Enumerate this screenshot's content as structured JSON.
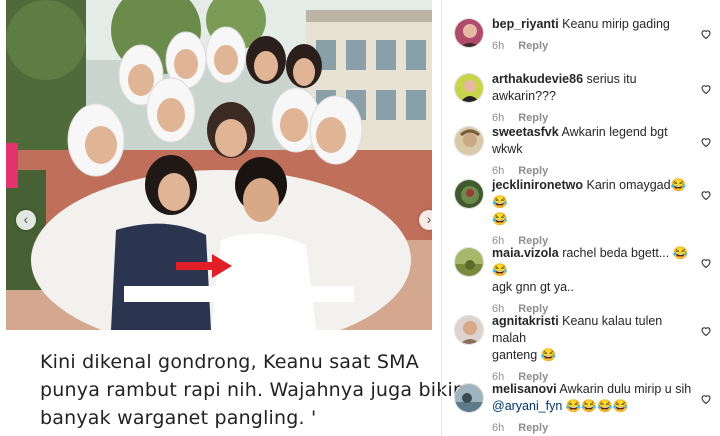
{
  "post": {
    "carousel": {
      "prev_icon": "‹",
      "next_icon": "›"
    },
    "caption_lines": [
      "Kini dikenal gondrong, Keanu saat SMA",
      "punya rambut rapi nih. Wajahnya juga bikin",
      "banyak warganet pangling. '"
    ]
  },
  "comments": [
    {
      "username": "bep_riyanti",
      "text": "Keanu mirip gading",
      "text2": "",
      "time": "6h",
      "reply": "Reply",
      "avatar_color": "#b04a6a"
    },
    {
      "username": "arthakudevie86",
      "text": "serius itu awkarin???",
      "text2": "",
      "time": "6h",
      "reply": "Reply",
      "avatar_color": "#c8d44a"
    },
    {
      "username": "sweetasfvk",
      "text": "Awkarin legend bgt wkwk",
      "text2": "",
      "time": "6h",
      "reply": "Reply",
      "avatar_color": "#d9c9a8"
    },
    {
      "username": "jecklinironetwo",
      "text": "Karin omaygad😂😂",
      "text2": "😂",
      "time": "6h",
      "reply": "Reply",
      "avatar_color": "#3f5a2e"
    },
    {
      "username": "maia.vizola",
      "text": "rachel beda bgett... 😂😂",
      "text2": "agk gnn gt ya..",
      "time": "6h",
      "reply": "Reply",
      "avatar_color": "#7b8a3a"
    },
    {
      "username": "agnitakristi",
      "text": "Keanu kalau tulen malah",
      "text2": "ganteng 😂",
      "time": "6h",
      "reply": "Reply",
      "avatar_color": "#8b6b5a"
    },
    {
      "username": "melisanovi",
      "text": "Awkarin dulu mirip u sih",
      "mention": "@aryani_fyn",
      "text2": " 😂😂😂😂",
      "time": "6h",
      "reply": "Reply",
      "avatar_color": "#5c7a8a"
    }
  ]
}
